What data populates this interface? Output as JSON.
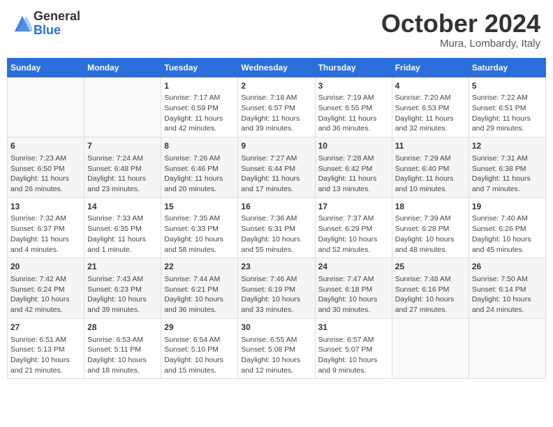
{
  "header": {
    "logo_general": "General",
    "logo_blue": "Blue",
    "month_title": "October 2024",
    "location": "Mura, Lombardy, Italy"
  },
  "days_of_week": [
    "Sunday",
    "Monday",
    "Tuesday",
    "Wednesday",
    "Thursday",
    "Friday",
    "Saturday"
  ],
  "weeks": [
    [
      {
        "day": "",
        "info": ""
      },
      {
        "day": "",
        "info": ""
      },
      {
        "day": "1",
        "info": "Sunrise: 7:17 AM\nSunset: 6:59 PM\nDaylight: 11 hours and 42 minutes."
      },
      {
        "day": "2",
        "info": "Sunrise: 7:18 AM\nSunset: 6:57 PM\nDaylight: 11 hours and 39 minutes."
      },
      {
        "day": "3",
        "info": "Sunrise: 7:19 AM\nSunset: 6:55 PM\nDaylight: 11 hours and 36 minutes."
      },
      {
        "day": "4",
        "info": "Sunrise: 7:20 AM\nSunset: 6:53 PM\nDaylight: 11 hours and 32 minutes."
      },
      {
        "day": "5",
        "info": "Sunrise: 7:22 AM\nSunset: 6:51 PM\nDaylight: 11 hours and 29 minutes."
      }
    ],
    [
      {
        "day": "6",
        "info": "Sunrise: 7:23 AM\nSunset: 6:50 PM\nDaylight: 11 hours and 26 minutes."
      },
      {
        "day": "7",
        "info": "Sunrise: 7:24 AM\nSunset: 6:48 PM\nDaylight: 11 hours and 23 minutes."
      },
      {
        "day": "8",
        "info": "Sunrise: 7:26 AM\nSunset: 6:46 PM\nDaylight: 11 hours and 20 minutes."
      },
      {
        "day": "9",
        "info": "Sunrise: 7:27 AM\nSunset: 6:44 PM\nDaylight: 11 hours and 17 minutes."
      },
      {
        "day": "10",
        "info": "Sunrise: 7:28 AM\nSunset: 6:42 PM\nDaylight: 11 hours and 13 minutes."
      },
      {
        "day": "11",
        "info": "Sunrise: 7:29 AM\nSunset: 6:40 PM\nDaylight: 11 hours and 10 minutes."
      },
      {
        "day": "12",
        "info": "Sunrise: 7:31 AM\nSunset: 6:38 PM\nDaylight: 11 hours and 7 minutes."
      }
    ],
    [
      {
        "day": "13",
        "info": "Sunrise: 7:32 AM\nSunset: 6:37 PM\nDaylight: 11 hours and 4 minutes."
      },
      {
        "day": "14",
        "info": "Sunrise: 7:33 AM\nSunset: 6:35 PM\nDaylight: 11 hours and 1 minute."
      },
      {
        "day": "15",
        "info": "Sunrise: 7:35 AM\nSunset: 6:33 PM\nDaylight: 10 hours and 58 minutes."
      },
      {
        "day": "16",
        "info": "Sunrise: 7:36 AM\nSunset: 6:31 PM\nDaylight: 10 hours and 55 minutes."
      },
      {
        "day": "17",
        "info": "Sunrise: 7:37 AM\nSunset: 6:29 PM\nDaylight: 10 hours and 52 minutes."
      },
      {
        "day": "18",
        "info": "Sunrise: 7:39 AM\nSunset: 6:28 PM\nDaylight: 10 hours and 48 minutes."
      },
      {
        "day": "19",
        "info": "Sunrise: 7:40 AM\nSunset: 6:26 PM\nDaylight: 10 hours and 45 minutes."
      }
    ],
    [
      {
        "day": "20",
        "info": "Sunrise: 7:42 AM\nSunset: 6:24 PM\nDaylight: 10 hours and 42 minutes."
      },
      {
        "day": "21",
        "info": "Sunrise: 7:43 AM\nSunset: 6:23 PM\nDaylight: 10 hours and 39 minutes."
      },
      {
        "day": "22",
        "info": "Sunrise: 7:44 AM\nSunset: 6:21 PM\nDaylight: 10 hours and 36 minutes."
      },
      {
        "day": "23",
        "info": "Sunrise: 7:46 AM\nSunset: 6:19 PM\nDaylight: 10 hours and 33 minutes."
      },
      {
        "day": "24",
        "info": "Sunrise: 7:47 AM\nSunset: 6:18 PM\nDaylight: 10 hours and 30 minutes."
      },
      {
        "day": "25",
        "info": "Sunrise: 7:48 AM\nSunset: 6:16 PM\nDaylight: 10 hours and 27 minutes."
      },
      {
        "day": "26",
        "info": "Sunrise: 7:50 AM\nSunset: 6:14 PM\nDaylight: 10 hours and 24 minutes."
      }
    ],
    [
      {
        "day": "27",
        "info": "Sunrise: 6:51 AM\nSunset: 5:13 PM\nDaylight: 10 hours and 21 minutes."
      },
      {
        "day": "28",
        "info": "Sunrise: 6:53 AM\nSunset: 5:11 PM\nDaylight: 10 hours and 18 minutes."
      },
      {
        "day": "29",
        "info": "Sunrise: 6:54 AM\nSunset: 5:10 PM\nDaylight: 10 hours and 15 minutes."
      },
      {
        "day": "30",
        "info": "Sunrise: 6:55 AM\nSunset: 5:08 PM\nDaylight: 10 hours and 12 minutes."
      },
      {
        "day": "31",
        "info": "Sunrise: 6:57 AM\nSunset: 5:07 PM\nDaylight: 10 hours and 9 minutes."
      },
      {
        "day": "",
        "info": ""
      },
      {
        "day": "",
        "info": ""
      }
    ]
  ]
}
